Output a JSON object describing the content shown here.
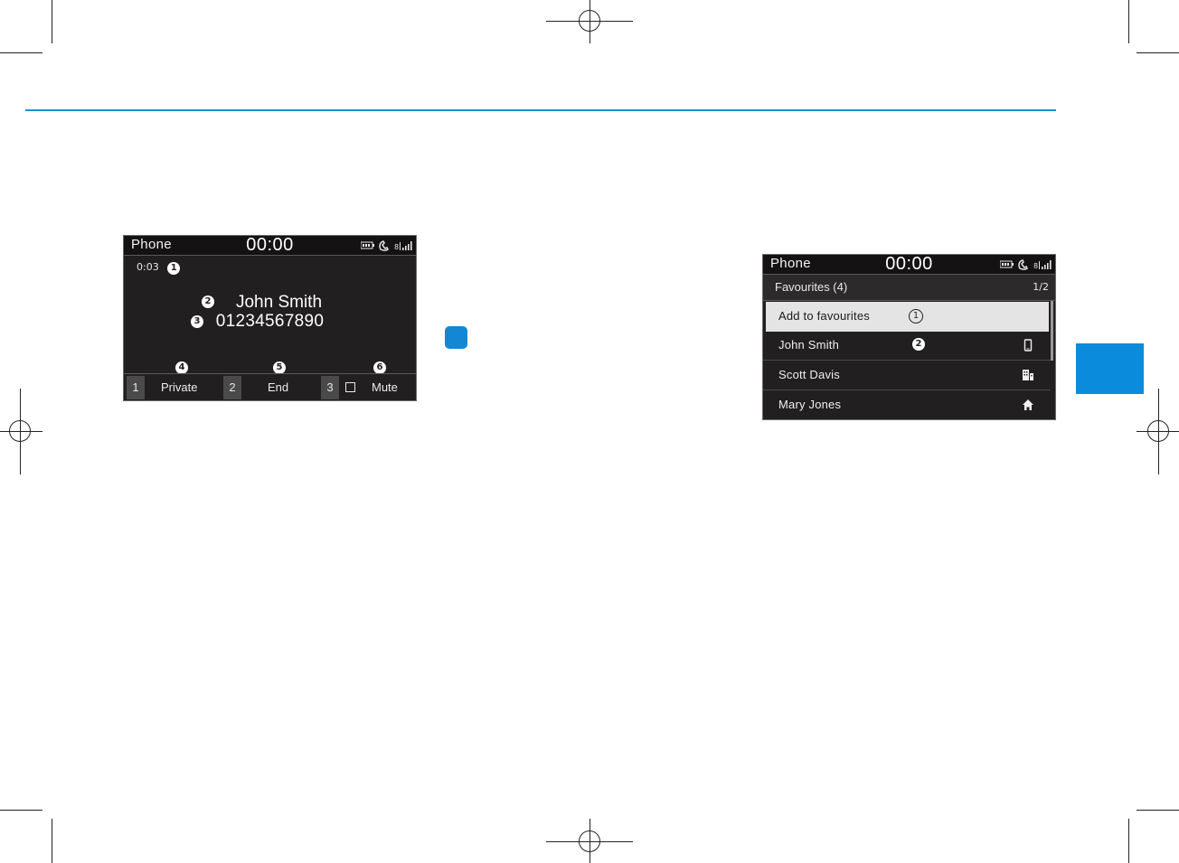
{
  "accent_color": "#1a8fd3",
  "tab_color": "#0b8bdb",
  "call_screen": {
    "status": {
      "title": "Phone",
      "clock": "00:00",
      "icons": [
        "battery-icon",
        "bluetooth-phone-icon",
        "signal-strength-icon"
      ]
    },
    "elapsed_time": "0:03",
    "callouts": [
      "1",
      "2",
      "3",
      "4",
      "5",
      "6"
    ],
    "caller_name": "John Smith",
    "caller_number": "01234567890",
    "softkeys": [
      {
        "number": "1",
        "label": "Private"
      },
      {
        "number": "2",
        "label": "End"
      },
      {
        "number": "3",
        "label": "Mute"
      }
    ]
  },
  "favourites_screen": {
    "status": {
      "title": "Phone",
      "clock": "00:00",
      "icons": [
        "battery-icon",
        "bluetooth-phone-icon",
        "signal-strength-icon"
      ]
    },
    "header": {
      "title": "Favourites (4)",
      "page": "1/2"
    },
    "items": [
      {
        "label": "Add to favourites",
        "callout": "1",
        "icon": ""
      },
      {
        "label": "John Smith",
        "callout": "2",
        "icon": "mobile-phone-icon"
      },
      {
        "label": "Scott Davis",
        "callout": "",
        "icon": "office-building-icon"
      },
      {
        "label": "Mary Jones",
        "callout": "",
        "icon": "home-icon"
      }
    ]
  }
}
